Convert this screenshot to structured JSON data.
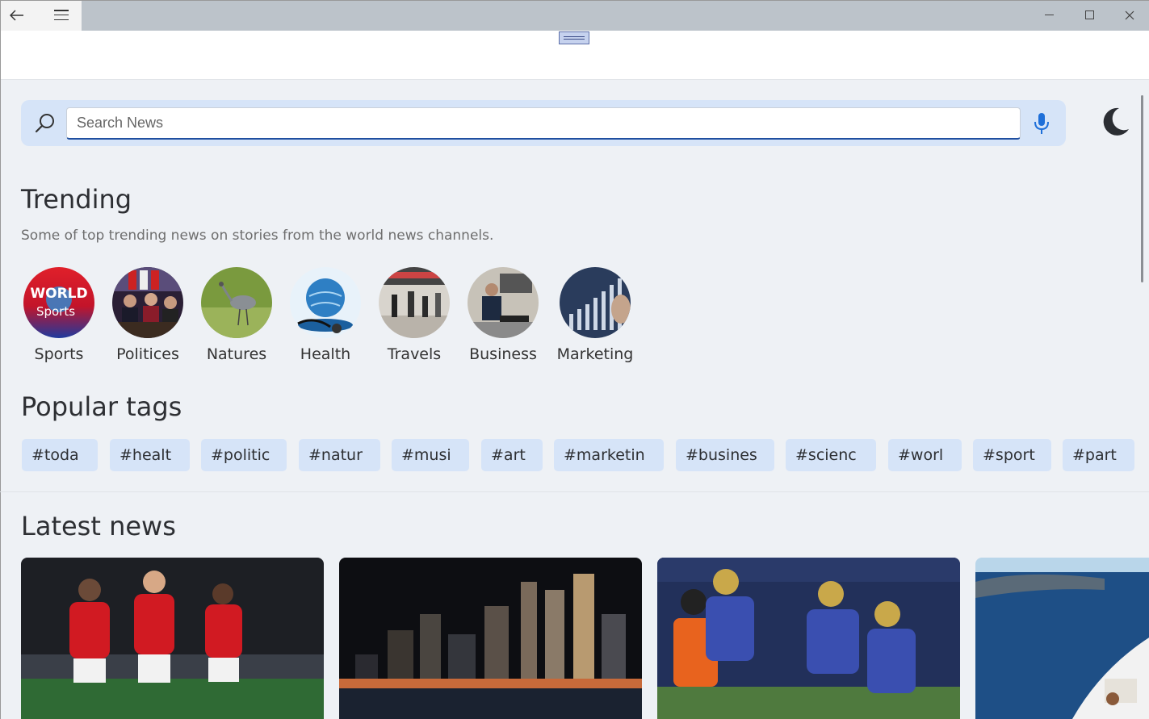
{
  "titlebar": {
    "back_icon": "back-arrow-icon",
    "menu_icon": "hamburger-icon",
    "minimize_icon": "minimize-icon",
    "maximize_icon": "maximize-icon",
    "close_icon": "close-icon"
  },
  "search": {
    "placeholder": "Search News",
    "search_icon": "search-icon",
    "mic_icon": "microphone-icon",
    "accent": "#1f4fa0"
  },
  "theme_toggle": {
    "icon": "moon-icon"
  },
  "trending": {
    "title": "Trending",
    "subtitle": "Some of top trending news on stories from the world news channels.",
    "categories": [
      {
        "label": "Sports",
        "image": "world-sports-logo"
      },
      {
        "label": "Politices",
        "image": "politicians-photo"
      },
      {
        "label": "Natures",
        "image": "crane-bird-photo"
      },
      {
        "label": "Health",
        "image": "globe-stethoscope-photo"
      },
      {
        "label": "Travels",
        "image": "airport-travelers-photo"
      },
      {
        "label": "Business",
        "image": "businessman-photo"
      },
      {
        "label": "Marketing",
        "image": "growth-chart-photo"
      }
    ]
  },
  "popular_tags": {
    "title": "Popular tags",
    "tags": [
      "#toda",
      "#healt",
      "#politic",
      "#natur",
      "#musi",
      "#art",
      "#marketin",
      "#busines",
      "#scienc",
      "#worl",
      "#sport",
      "#part"
    ]
  },
  "latest_news": {
    "title": "Latest news",
    "cards": [
      {
        "image": "football-players-celebrating-photo"
      },
      {
        "image": "city-skyline-night-photo"
      },
      {
        "image": "american-football-game-photo"
      },
      {
        "image": "coastal-cliff-sea-photo"
      }
    ]
  }
}
